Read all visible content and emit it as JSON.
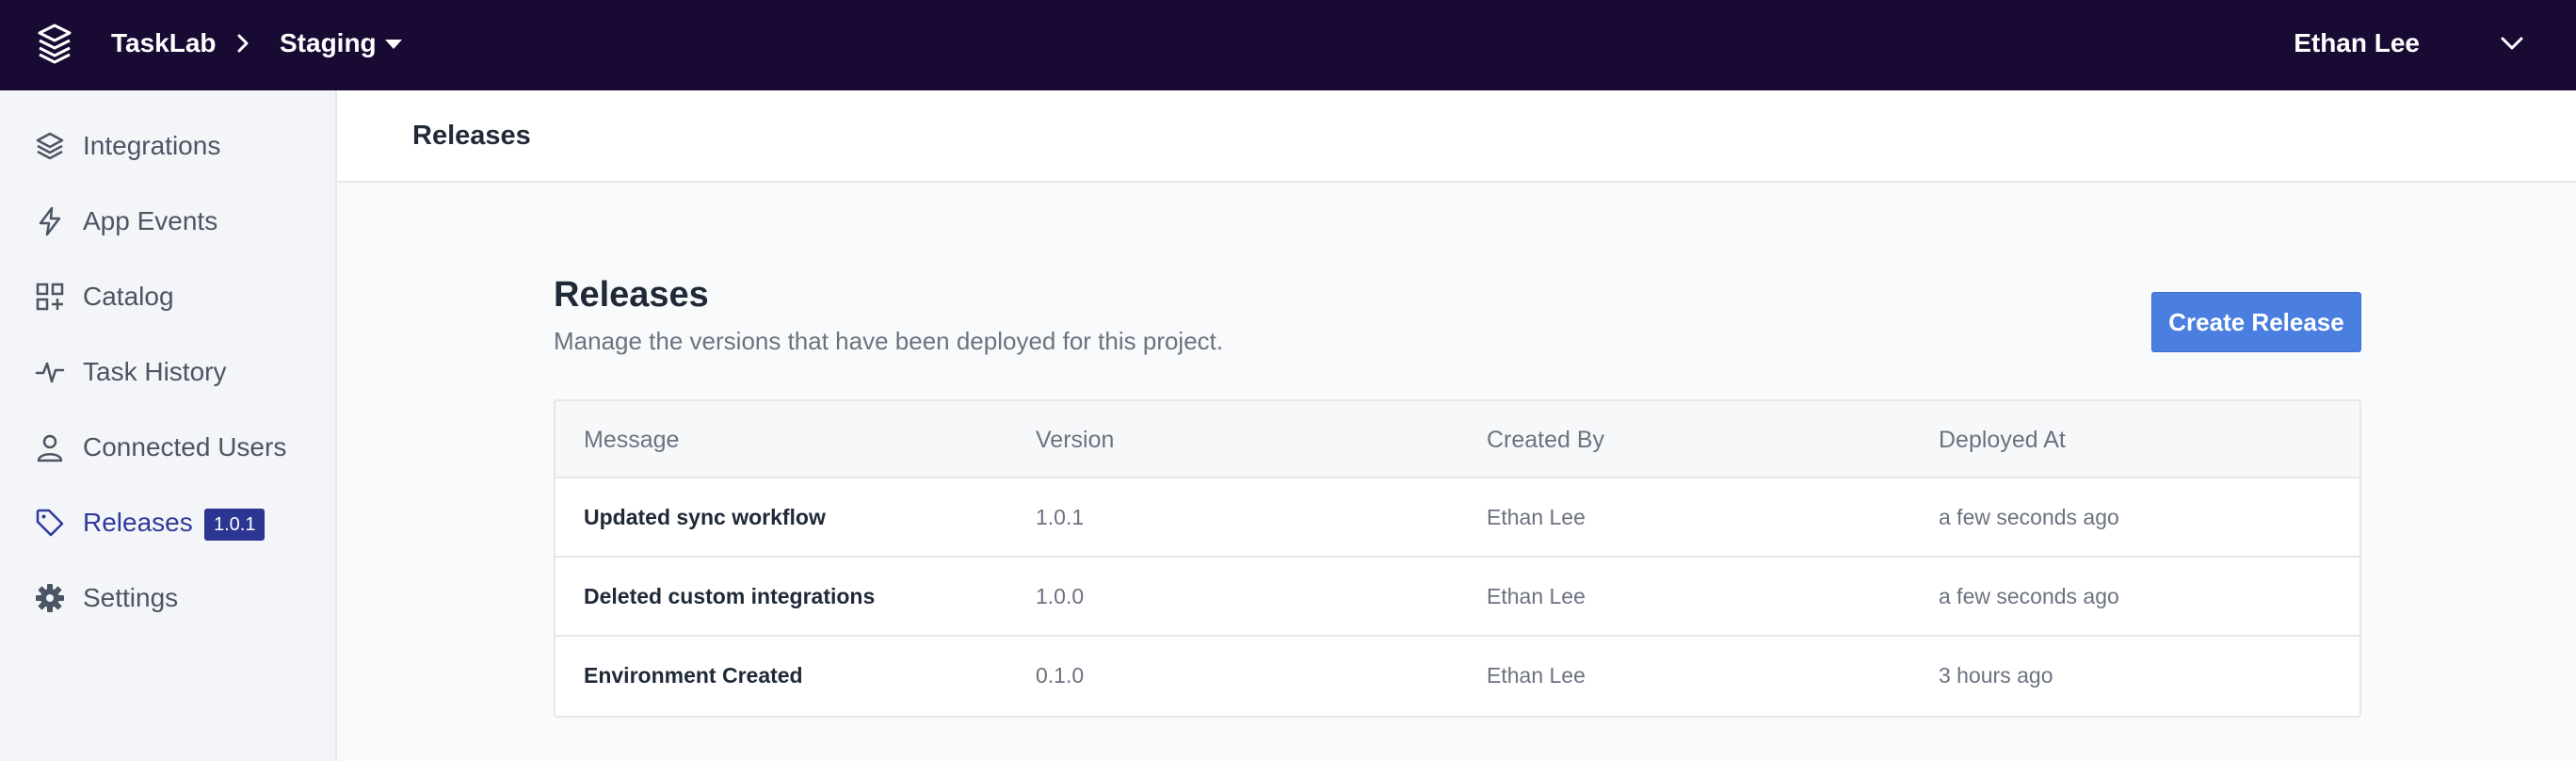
{
  "topbar": {
    "app_name": "TaskLab",
    "environment": "Staging",
    "user_name": "Ethan Lee"
  },
  "sidebar": {
    "items": [
      {
        "label": "Integrations",
        "icon": "layers-icon"
      },
      {
        "label": "App Events",
        "icon": "bolt-icon"
      },
      {
        "label": "Catalog",
        "icon": "grid-plus-icon"
      },
      {
        "label": "Task History",
        "icon": "pulse-icon"
      },
      {
        "label": "Connected Users",
        "icon": "user-icon"
      },
      {
        "label": "Releases",
        "icon": "tag-icon",
        "badge": "1.0.1",
        "active": true
      },
      {
        "label": "Settings",
        "icon": "gear-icon"
      }
    ]
  },
  "page_header": {
    "title": "Releases"
  },
  "main": {
    "title": "Releases",
    "subtitle": "Manage the versions that have been deployed for this project.",
    "create_button_label": "Create Release",
    "table": {
      "columns": [
        "Message",
        "Version",
        "Created By",
        "Deployed At"
      ],
      "rows": [
        {
          "message": "Updated sync workflow",
          "version": "1.0.1",
          "created_by": "Ethan Lee",
          "deployed_at": "a few seconds ago"
        },
        {
          "message": "Deleted custom integrations",
          "version": "1.0.0",
          "created_by": "Ethan Lee",
          "deployed_at": "a few seconds ago"
        },
        {
          "message": "Environment Created",
          "version": "0.1.0",
          "created_by": "Ethan Lee",
          "deployed_at": "3 hours ago"
        }
      ]
    }
  },
  "colors": {
    "topbar_bg": "#180a33",
    "accent": "#4a7fe0",
    "active_nav": "#2f3a9b",
    "badge_bg": "#2c3592"
  }
}
